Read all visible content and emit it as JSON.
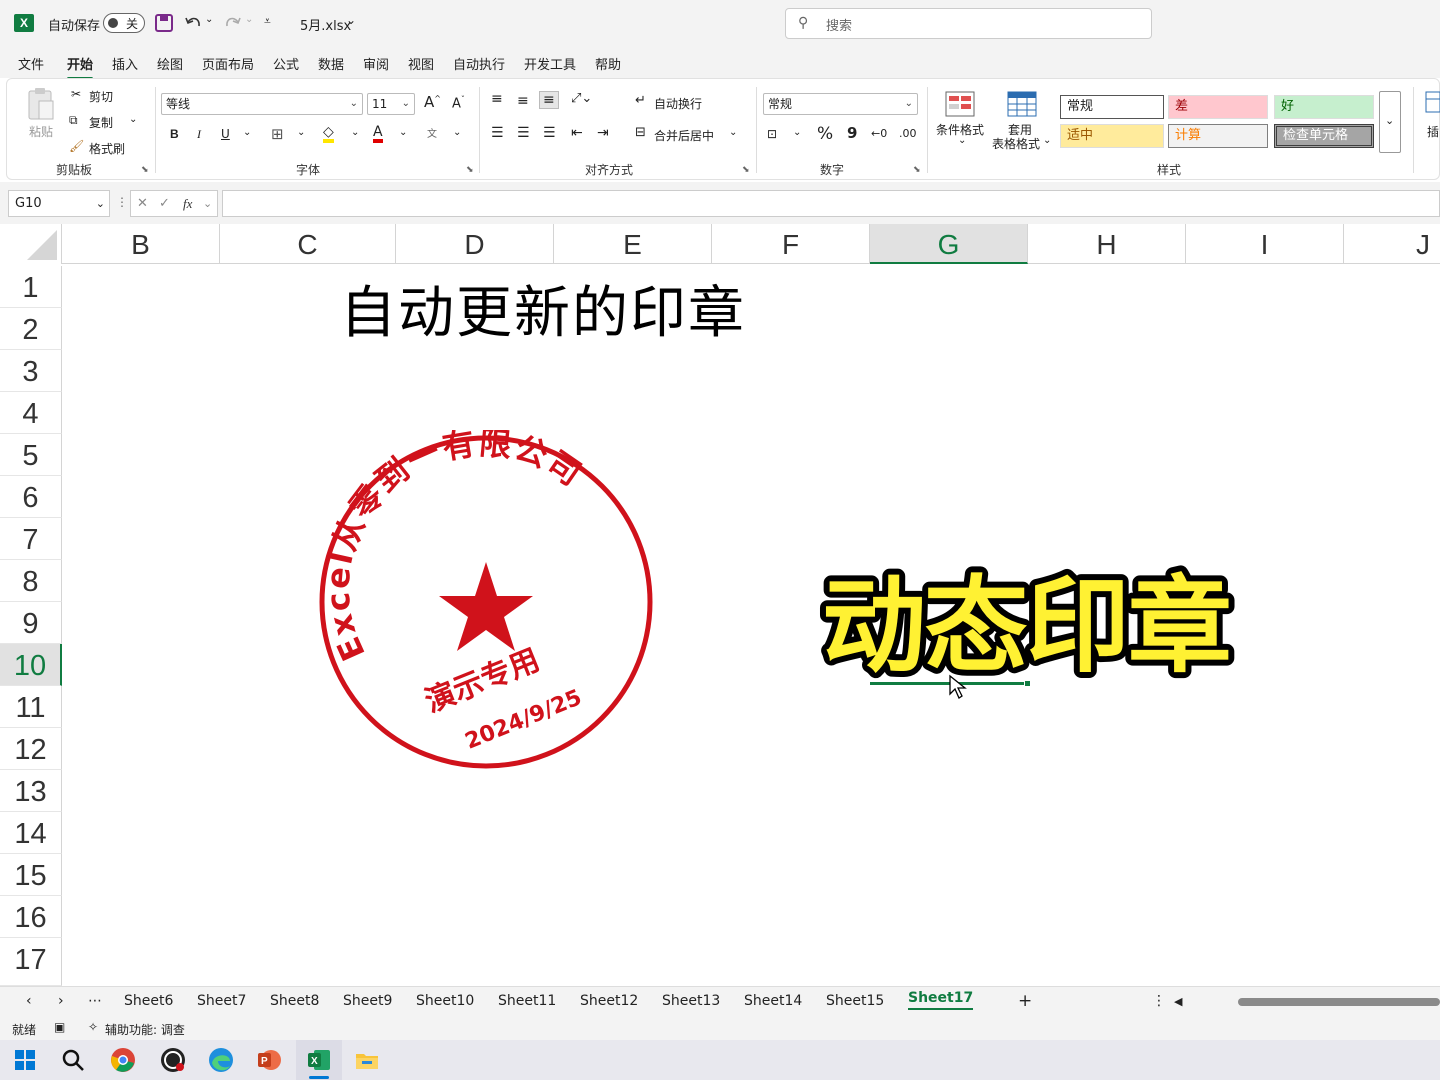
{
  "titlebar": {
    "autosave_label": "自动保存",
    "autosave_state": "关",
    "filename": "5月.xlsx",
    "search_placeholder": "搜索"
  },
  "menu": [
    "文件",
    "开始",
    "插入",
    "绘图",
    "页面布局",
    "公式",
    "数据",
    "审阅",
    "视图",
    "自动执行",
    "开发工具",
    "帮助"
  ],
  "menu_active": "开始",
  "ribbon": {
    "clipboard": {
      "paste": "粘贴",
      "cut": "剪切",
      "copy": "复制",
      "format_painter": "格式刷",
      "label": "剪贴板"
    },
    "font": {
      "name": "等线",
      "size": "11",
      "label": "字体",
      "bold": "B",
      "italic": "I",
      "underline": "U"
    },
    "alignment": {
      "wrap": "自动换行",
      "merge": "合并后居中",
      "label": "对齐方式"
    },
    "number": {
      "format": "常规",
      "percent": "%",
      "comma": "9",
      "label": "数字"
    },
    "styles": {
      "conditional": "条件格式",
      "table_format_1": "套用",
      "table_format_2": "表格格式",
      "cells": [
        "常规",
        "差",
        "好",
        "适中",
        "计算",
        "检查单元格"
      ],
      "label": "样式"
    },
    "insert_partial": "插"
  },
  "formula_bar": {
    "cell_ref": "G10",
    "fx": "fx",
    "content": ""
  },
  "columns": [
    "B",
    "C",
    "D",
    "E",
    "F",
    "G",
    "H",
    "I",
    "J"
  ],
  "selected_column": "G",
  "rows": [
    "1",
    "2",
    "3",
    "4",
    "5",
    "6",
    "7",
    "8",
    "9",
    "10",
    "11",
    "12",
    "13",
    "14",
    "15",
    "16",
    "17"
  ],
  "selected_row": "10",
  "content": {
    "title": "自动更新的印章",
    "stamp": {
      "company": "Excel从零到一有限公司",
      "purpose": "演示专用",
      "date": "2024/9/25",
      "color": "#d0121b"
    },
    "dynamic_label": "动态印章"
  },
  "sheet_tabs": [
    "Sheet6",
    "Sheet7",
    "Sheet8",
    "Sheet9",
    "Sheet10",
    "Sheet11",
    "Sheet12",
    "Sheet13",
    "Sheet14",
    "Sheet15",
    "Sheet17"
  ],
  "active_sheet": "Sheet17",
  "statusbar": {
    "ready": "就绪",
    "accessibility": "辅助功能: 调查"
  },
  "colors": {
    "accent": "#107c41",
    "title_yellow": "#fff133"
  }
}
